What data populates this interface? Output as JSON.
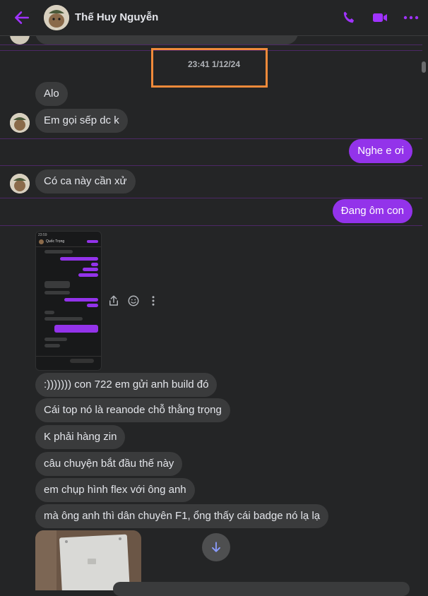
{
  "header": {
    "contact_name": "Thế Huy Nguyễn",
    "icons": [
      "back-arrow-icon",
      "avatar",
      "phone-icon",
      "video-icon",
      "more-icon"
    ],
    "accent_color": "#a033ff"
  },
  "thread": {
    "prev_bubble_tail": "...",
    "timestamp": "23:41 1/12/24",
    "messages": [
      {
        "from": "them",
        "text": "Alo"
      },
      {
        "from": "them",
        "text": "Em gọi sếp dc k"
      },
      {
        "from": "me",
        "text": "Nghe e ơi"
      },
      {
        "from": "them",
        "text": "Có ca này cần xử"
      },
      {
        "from": "me",
        "text": "Đang ôm con"
      },
      {
        "from": "them",
        "text": ":))))))) con 722 em gửi anh build đó"
      },
      {
        "from": "them",
        "text": "Cái top nó là reanode chỗ thằng trọng"
      },
      {
        "from": "them",
        "text": "K phải hàng zin"
      },
      {
        "from": "them",
        "text": "câu chuyện bắt đầu thế này"
      },
      {
        "from": "them",
        "text": "em chụp hình flex với ông anh"
      },
      {
        "from": "them",
        "text": "mà ông anh thì dân chuyên F1, ổng thấy cái badge nó lạ lạ"
      }
    ],
    "screenshot_attachment": {
      "contact": "Quốc Trọng",
      "time": "23:59"
    }
  },
  "colors": {
    "background": "#242526",
    "bubble_in": "#3a3b3c",
    "bubble_out": "#9333ea",
    "highlight": "#f08a3a"
  }
}
